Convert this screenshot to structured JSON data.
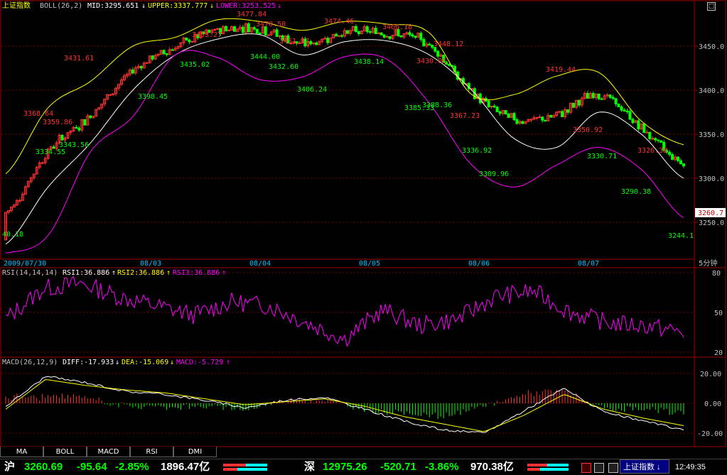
{
  "main_header": {
    "name": "上证指数",
    "indicator": "BOLL(26,2)",
    "mid": "MID:3295.651",
    "upper": "UPPER:3337.777",
    "lower": "LOWER:3253.525"
  },
  "price_axis": [
    "3450.0",
    "3400.0",
    "3350.0",
    "3300.0",
    "3250.0"
  ],
  "current_price_label": "3260.7",
  "date_labels": [
    "2009/07/30",
    "08/03",
    "08/04",
    "08/05",
    "08/06",
    "08/07"
  ],
  "period_label": "5分钟",
  "annotations": [
    {
      "text": "40.18",
      "color": "#00ff00"
    },
    {
      "text": "3368.64",
      "color": "#ff3232"
    },
    {
      "text": "3359.86",
      "color": "#ff3232"
    },
    {
      "text": "3334.55",
      "color": "#00ff00"
    },
    {
      "text": "3343.56",
      "color": "#00ff00"
    },
    {
      "text": "3431.61",
      "color": "#ff3232"
    },
    {
      "text": "3398.45",
      "color": "#00ff00"
    },
    {
      "text": "3453.27",
      "color": "#ff3232"
    },
    {
      "text": "3435.02",
      "color": "#00ff00"
    },
    {
      "text": "3477.84",
      "color": "#ff3232"
    },
    {
      "text": "3470.50",
      "color": "#ff3232"
    },
    {
      "text": "3451.17",
      "color": "#ff3232"
    },
    {
      "text": "3444.00",
      "color": "#00ff00"
    },
    {
      "text": "3432.60",
      "color": "#00ff00"
    },
    {
      "text": "3406.24",
      "color": "#00ff00"
    },
    {
      "text": "3474.46",
      "color": "#ff3232"
    },
    {
      "text": "3438.14",
      "color": "#00ff00"
    },
    {
      "text": "3466.18",
      "color": "#ff3232"
    },
    {
      "text": "3448.12",
      "color": "#ff3232"
    },
    {
      "text": "3430.06",
      "color": "#ff3232"
    },
    {
      "text": "3385.33",
      "color": "#00ff00"
    },
    {
      "text": "3388.36",
      "color": "#00ff00"
    },
    {
      "text": "3367.23",
      "color": "#ff3232"
    },
    {
      "text": "3336.92",
      "color": "#00ff00"
    },
    {
      "text": "3309.96",
      "color": "#00ff00"
    },
    {
      "text": "3419.44",
      "color": "#ff3232"
    },
    {
      "text": "3350.92",
      "color": "#ff3232"
    },
    {
      "text": "3330.71",
      "color": "#00ff00"
    },
    {
      "text": "3326.38",
      "color": "#ff3232"
    },
    {
      "text": "3290.38",
      "color": "#00ff00"
    },
    {
      "text": "3244.1",
      "color": "#00ff00"
    }
  ],
  "rsi_header": {
    "indicator": "RSI(14,14,14)",
    "rsi1": "RSI1:36.886",
    "rsi2": "RSI2:36.886",
    "rsi3": "RSI3:36.886"
  },
  "rsi_axis": [
    "80",
    "50",
    "20"
  ],
  "macd_header": {
    "indicator": "MACD(26,12,9)",
    "diff": "DIFF:-17.933",
    "dea": "DEA:-15.069",
    "macd": "MACD:-5.729"
  },
  "macd_axis": [
    "20.00",
    "0.00",
    "-20.00"
  ],
  "tabs": [
    "MA",
    "BOLL",
    "MACD",
    "RSI",
    "DMI"
  ],
  "status_bar": {
    "sh_label": "沪",
    "sh_index": "3260.69",
    "sh_change": "-95.64",
    "sh_pct": "-2.85%",
    "sh_volume": "1896.47亿",
    "sz_label": "深",
    "sz_index": "12975.26",
    "sz_change": "-520.71",
    "sz_pct": "-3.86%",
    "sz_volume": "970.38亿",
    "ticker": "上证指数",
    "time": "12:49:35"
  },
  "colors": {
    "up": "#ff3232",
    "down": "#00ff00",
    "mid_line": "#ffffff",
    "upper_line": "#ffff00",
    "lower_line": "#ff00ff",
    "frame": "#a00000"
  },
  "chart_data": {
    "type": "line",
    "title": "上证指数 BOLL(26,2)",
    "x": [
      "2009/07/30",
      "08/03",
      "08/04",
      "08/05",
      "08/06",
      "08/07"
    ],
    "ylim": [
      3215,
      3485
    ],
    "series": [
      {
        "name": "MID",
        "values": [
          3225,
          3290,
          3340,
          3400,
          3440,
          3458,
          3463,
          3440,
          3455,
          3456,
          3440,
          3400,
          3345,
          3335,
          3375,
          3350,
          3300
        ]
      },
      {
        "name": "UPPER",
        "values": [
          3305,
          3380,
          3410,
          3450,
          3460,
          3480,
          3478,
          3468,
          3478,
          3475,
          3465,
          3395,
          3395,
          3416,
          3420,
          3365,
          3338
        ]
      },
      {
        "name": "LOWER",
        "values": [
          3215,
          3235,
          3330,
          3370,
          3440,
          3437,
          3412,
          3415,
          3438,
          3435,
          3385,
          3315,
          3290,
          3315,
          3335,
          3310,
          3255
        ]
      }
    ],
    "rsi_ylim": [
      20,
      80
    ],
    "macd_ylim": [
      -20,
      20
    ],
    "last_values": {
      "MID": 3295.651,
      "UPPER": 3337.777,
      "LOWER": 3253.525,
      "RSI": 36.886,
      "DIFF": -17.933,
      "DEA": -15.069,
      "MACD": -5.729
    }
  }
}
